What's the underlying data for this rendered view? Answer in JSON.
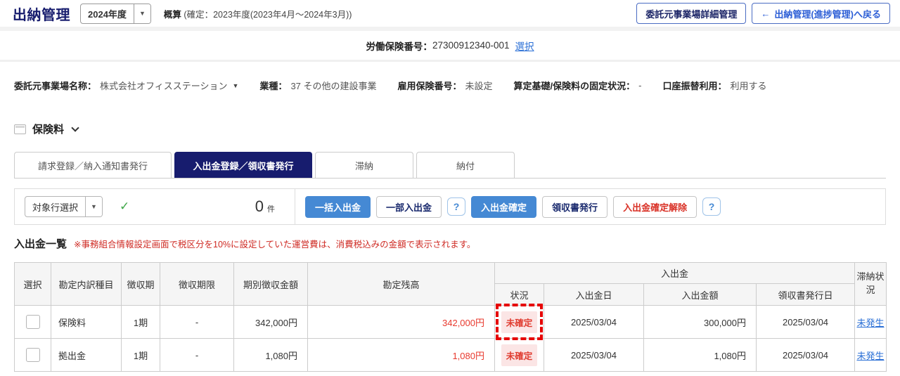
{
  "colors": {
    "navy": "#171c6e",
    "primary_blue": "#4589d4",
    "link_blue": "#2a6fd6",
    "value_red": "#e8382d",
    "badge_bg": "#fbe5e5",
    "highlight_dash_red": "#e60000",
    "check_green": "#3fa648"
  },
  "header": {
    "title": "出納管理",
    "year_value": "2024年度",
    "caret": "▼",
    "summary_label": "概算",
    "summary_detail": "(確定：2023年度(2023年4月～2024年3月))",
    "manage_button": "委託元事業場詳細管理",
    "back_arrow": "←",
    "back_button": "出納管理(進捗管理)へ戻る"
  },
  "insurance_bar": {
    "label": "労働保険番号：",
    "number": "27300912340-001",
    "select_link": "選択"
  },
  "info": {
    "fields": [
      {
        "label": "委託元事業場名称：",
        "value": "株式会社オフィスステーション",
        "caret": "▼"
      },
      {
        "label": "業種：",
        "value": "37 その他の建設事業"
      },
      {
        "label": "雇用保険番号：",
        "value": "未設定"
      },
      {
        "label": "算定基礎/保険料の固定状況：",
        "value": "-"
      },
      {
        "label": "口座振替利用：",
        "value": "利用する"
      }
    ]
  },
  "section": {
    "title": "保険料"
  },
  "tabs": [
    {
      "label": "請求登録／納入通知書発行",
      "active": false
    },
    {
      "label": "入出金登録／領収書発行",
      "active": true
    },
    {
      "label": "滞納",
      "active": false
    },
    {
      "label": "納付",
      "active": false
    }
  ],
  "toolbar": {
    "row_select": "対象行選択",
    "caret": "▼",
    "check": "✓",
    "count": "0",
    "count_unit": "件",
    "btn_bulk": "一括入出金",
    "btn_partial": "一部入出金",
    "help1": "?",
    "btn_confirm": "入出金確定",
    "btn_receipt": "領収書発行",
    "btn_unconfirm": "入出金確定解除",
    "help2": "?"
  },
  "list": {
    "title": "入出金一覧",
    "note": "※事務組合情報設定画面で税区分を10%に設定していた運営費は、消費税込みの金額で表示されます。"
  },
  "table": {
    "group_header": "入出金",
    "headers": {
      "select": "選択",
      "item": "勘定内訳種目",
      "period": "徴収期",
      "deadline": "徴収期限",
      "period_amount": "期別徴収金額",
      "balance": "勘定残高",
      "status": "状況",
      "pay_date": "入出金日",
      "pay_amount": "入出金額",
      "receipt_date": "領収書発行日",
      "arrears": "滞納状況"
    },
    "rows": [
      {
        "item": "保険料",
        "period": "1期",
        "deadline": "-",
        "period_amount": "342,000円",
        "balance": "342,000円",
        "status": "未確定",
        "pay_date": "2025/03/04",
        "pay_amount": "300,000円",
        "receipt_date": "2025/03/04",
        "arrears": "未発生",
        "highlighted": true
      },
      {
        "item": "拠出金",
        "period": "1期",
        "deadline": "-",
        "period_amount": "1,080円",
        "balance": "1,080円",
        "status": "未確定",
        "pay_date": "2025/03/04",
        "pay_amount": "1,080円",
        "receipt_date": "2025/03/04",
        "arrears": "未発生",
        "highlighted": false
      }
    ]
  }
}
